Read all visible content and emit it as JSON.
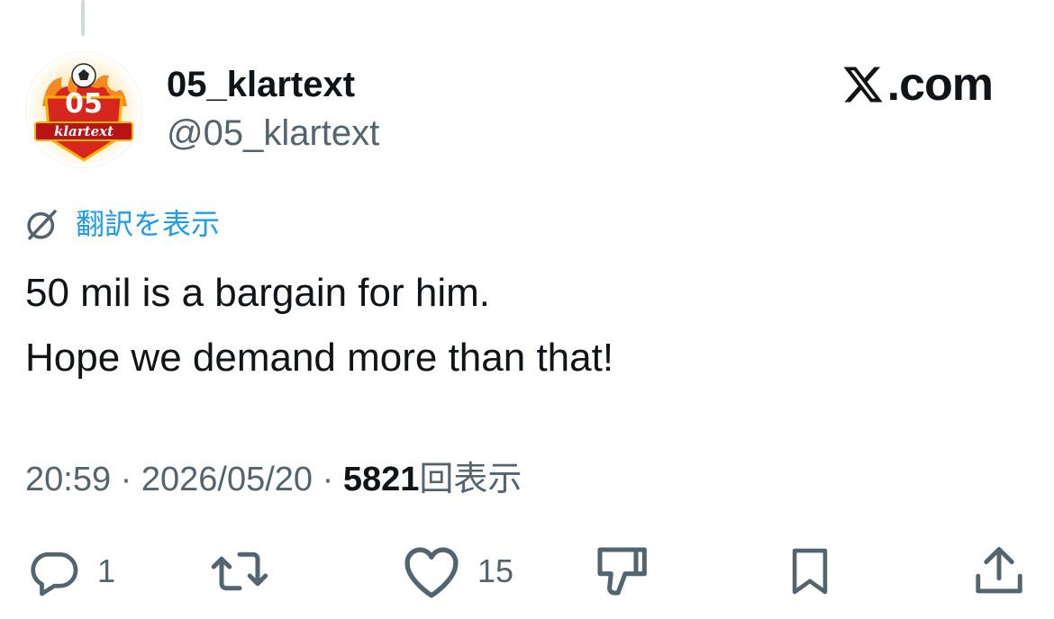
{
  "tweet": {
    "display_name": "05_klartext",
    "handle": "@05_klartext",
    "avatar_text_top": "05",
    "avatar_text_bottom": "klartext",
    "brand": "X.com",
    "translate_label": "翻訳を表示",
    "text_lines": [
      "50 mil is a bargain for him.",
      "Hope we demand more than that!"
    ],
    "time": "20:59",
    "date": "2026/05/20",
    "separator": "·",
    "views_count": "5821",
    "views_label": "回表示"
  },
  "actions": {
    "reply_count": "1",
    "like_count": "15"
  },
  "icons": {
    "reply": "reply-icon",
    "retweet": "retweet-icon",
    "like": "heart-icon",
    "dislike": "thumbs-down-icon",
    "bookmark": "bookmark-icon",
    "share": "share-icon",
    "translate": "globe-slash-icon",
    "brand": "x-logo-icon"
  },
  "colors": {
    "text": "#0f1419",
    "secondary": "#536471",
    "link": "#1d9bf0",
    "thread_line": "#cfd9de",
    "avatar_red": "#d7261e",
    "avatar_orange": "#f58a1f"
  }
}
